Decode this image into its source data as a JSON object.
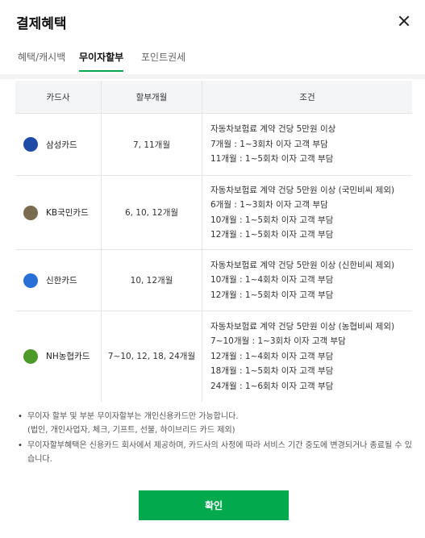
{
  "header": {
    "title": "결제혜택",
    "close_label": "닫기"
  },
  "tabs": [
    {
      "label": "혜택/캐시백",
      "active": false
    },
    {
      "label": "무이자할부",
      "active": true
    },
    {
      "label": "포인트권세",
      "active": false
    }
  ],
  "table": {
    "columns": [
      "카드사",
      "할부개월",
      "조건"
    ],
    "rows": [
      {
        "card": "삼성카드",
        "logo_color": "#1f4aa5",
        "months": "7, 11개월",
        "conditions": [
          "자동차보험료 계약 건당 5만원 이상",
          "7개월 : 1~3회차 이자 고객 부담",
          "11개월 : 1~5회차 이자 고객 부담"
        ]
      },
      {
        "card": "KB국민카드",
        "logo_color": "#7a6a4f",
        "months": "6, 10, 12개월",
        "conditions": [
          "자동차보험료 계약 건당 5만원 이상 (국민비씨 제외)",
          "6개월 : 1~3회차 이자 고객 부담",
          "10개월 : 1~5회차 이자 고객 부담",
          "12개월 : 1~5회차 이자 고객 부담"
        ]
      },
      {
        "card": "신한카드",
        "logo_color": "#2a6fd6",
        "months": "10, 12개월",
        "conditions": [
          "자동차보험료 계약 건당 5만원 이상 (신한비씨 제외)",
          "10개월 : 1~4회차 이자 고객 부담",
          "12개월 : 1~5회차 이자 고객 부담"
        ]
      },
      {
        "card": "NH농협카드",
        "logo_color": "#4c9a2a",
        "months": "7~10, 12, 18, 24개월",
        "conditions": [
          "자동차보험료 계약 건당 5만원 이상 (농협비씨 제외)",
          "7~10개월 : 1~3회차 이자 고객 부담",
          "12개월 : 1~4회차 이자 고객 부담",
          "18개월 : 1~5회차 이자 고객 부담",
          "24개월 : 1~6회차 이자 고객 부담"
        ]
      }
    ]
  },
  "notes": [
    {
      "line1": "무이자 할부 및 부분 무이자할부는 개인신용카드만 가능합니다.",
      "line2": "(법인, 개인사업자, 체크, 기프트, 선불, 하이브리드 카드 제외)"
    },
    {
      "line1": "무이자할부혜택은 신용카드 회사에서 제공하며, 카드사의 사정에 따라 서비스 기간 중도에 변경되거나 종료될 수 있습니다."
    }
  ],
  "confirm_label": "확인"
}
